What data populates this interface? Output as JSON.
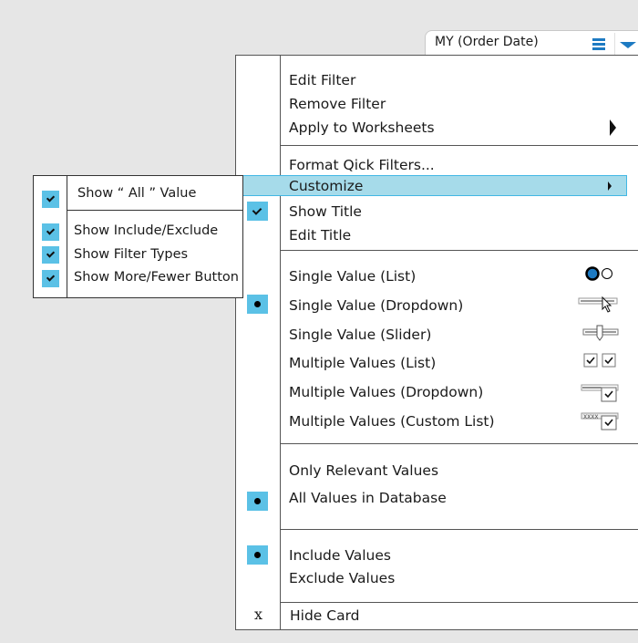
{
  "card": {
    "title": "MY (Order Date)",
    "menu_icon": "hamburger-icon",
    "dropdown_icon": "caret-down-icon"
  },
  "colors": {
    "accent_blue": "#1d7ac2",
    "marker_blue": "#5bc1e6",
    "highlight_fill": "#a6dbea",
    "highlight_border": "#42b7e4",
    "background": "#e6e6e6"
  },
  "menu": {
    "section1": {
      "edit_filter": "Edit Filter",
      "remove_filter": "Remove Filter",
      "apply_to_worksheets": "Apply to Worksheets"
    },
    "section2": {
      "format_quick_filters": "Format Qick Filters...",
      "customize": "Customize",
      "show_title": "Show Title",
      "show_title_checked": true,
      "edit_title": "Edit Title"
    },
    "filter_types": {
      "selected": "Single Value  (Dropdown)",
      "items": [
        {
          "label": "Single Value  (List)",
          "icon": "radio-buttons-icon"
        },
        {
          "label": "Single Value  (Dropdown)",
          "icon": "dropdown-cursor-icon"
        },
        {
          "label": "Single Value  (Slider)",
          "icon": "slider-icon"
        },
        {
          "label": "Multiple Values (List)",
          "icon": "checkboxes-icon"
        },
        {
          "label": "Multiple Values  (Dropdown)",
          "icon": "dropdown-checkbox-icon"
        },
        {
          "label": "Multiple Values  (Custom List)",
          "icon": "custom-list-checkbox-icon"
        }
      ],
      "custom_list_placeholder": "XXXX"
    },
    "values_scope": {
      "selected": "All Values in Database",
      "items": [
        "Only Relevant Values",
        "All Values in Database"
      ]
    },
    "include_exclude": {
      "selected": "Include Values",
      "items": [
        "Include Values",
        "Exclude Values"
      ]
    },
    "hide_card": {
      "glyph": "x",
      "label": "Hide Card"
    }
  },
  "customize_submenu": {
    "items": [
      {
        "label": "Show “ All ” Value",
        "checked": true
      },
      {
        "label": "Show Include/Exclude",
        "checked": true
      },
      {
        "label": "Show Filter Types",
        "checked": true
      },
      {
        "label": "Show More/Fewer Button",
        "checked": true
      }
    ]
  }
}
